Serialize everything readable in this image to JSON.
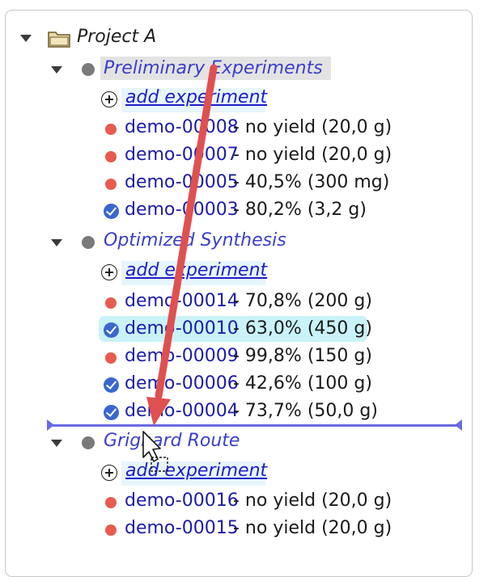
{
  "project": {
    "label": "Project A"
  },
  "groups": [
    {
      "label": "Preliminary Experiments",
      "add_label": "add experiment",
      "experiments": [
        {
          "id": "demo-00008",
          "result": " - no yield (20,0 g)",
          "status": "failed"
        },
        {
          "id": "demo-00007",
          "result": " - no yield (20,0 g)",
          "status": "failed"
        },
        {
          "id": "demo-00005",
          "result": " - 40,5% (300 mg)",
          "status": "failed"
        },
        {
          "id": "demo-00003",
          "result": " - 80,2% (3,2 g)",
          "status": "done"
        }
      ]
    },
    {
      "label": "Optimized Synthesis",
      "add_label": "add experiment",
      "experiments": [
        {
          "id": "demo-00014",
          "result": " - 70,8% (200 g)",
          "status": "failed"
        },
        {
          "id": "demo-00010",
          "result": " - 63,0% (450 g)",
          "status": "done"
        },
        {
          "id": "demo-00009",
          "result": " - 99,8% (150 g)",
          "status": "failed"
        },
        {
          "id": "demo-00006",
          "result": " - 42,6% (100 g)",
          "status": "done"
        },
        {
          "id": "demo-00004",
          "result": " - 73,7% (50,0 g)",
          "status": "done"
        }
      ]
    },
    {
      "label": "Grignard Route",
      "add_label": "add experiment",
      "experiments": [
        {
          "id": "demo-00016",
          "result": " - no yield (20,0 g)",
          "status": "failed"
        },
        {
          "id": "demo-00015",
          "result": " - no yield (20,0 g)",
          "status": "failed"
        }
      ]
    }
  ],
  "colors": {
    "link": "#1c1ca8",
    "group": "#3a3fc8",
    "failed_dot": "#e85b4f",
    "done_check": "#3a67cf",
    "drop_indicator": "#6a6ae0",
    "drag_arrow": "#e05050"
  },
  "icons": {
    "expand": "chevron-down-icon",
    "folder": "folder-icon",
    "add": "plus-circle-icon",
    "failed": "red-dot-icon",
    "done": "check-circle-icon",
    "cursor": "drag-cursor-icon"
  }
}
